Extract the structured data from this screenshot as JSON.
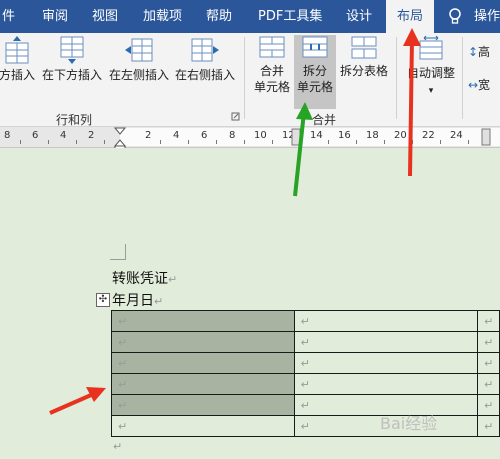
{
  "tabs": [
    {
      "label": "件"
    },
    {
      "label": "审阅"
    },
    {
      "label": "视图"
    },
    {
      "label": "加载项"
    },
    {
      "label": "帮助"
    },
    {
      "label": "PDF工具集"
    },
    {
      "label": "设计"
    },
    {
      "label": "布局"
    },
    {
      "label": "操作"
    }
  ],
  "ribbon": {
    "insert_above": "方插入",
    "insert_below": "在下方插入",
    "insert_left": "在左侧插入",
    "insert_right": "在右侧插入",
    "group_rows_cols": "行和列",
    "merge_cells_l1": "合并",
    "merge_cells_l2": "单元格",
    "split_cells_l1": "拆分",
    "split_cells_l2": "单元格",
    "split_table": "拆分表格",
    "group_merge": "合并",
    "autofit": "自动调整",
    "height_label": "高",
    "width_label": "宽"
  },
  "ruler": {
    "numbers": [
      "8",
      "6",
      "4",
      "2",
      "2",
      "4",
      "6",
      "8",
      "10",
      "12",
      "14",
      "16",
      "18",
      "20",
      "22",
      "24"
    ]
  },
  "document": {
    "title": "转账凭证",
    "date_line": "年月日",
    "paragraph_mark": "↵",
    "table_move_handle": "✣",
    "rows": 6
  },
  "watermark": "Bai经验",
  "colors": {
    "tab_bar": "#2b579a",
    "ribbon_bg": "#f3f3f3",
    "doc_bg": "#e2ecda",
    "selected_cells": "#a9b3a1",
    "red_arrow": "#e8321f",
    "green_arrow": "#27a325"
  }
}
